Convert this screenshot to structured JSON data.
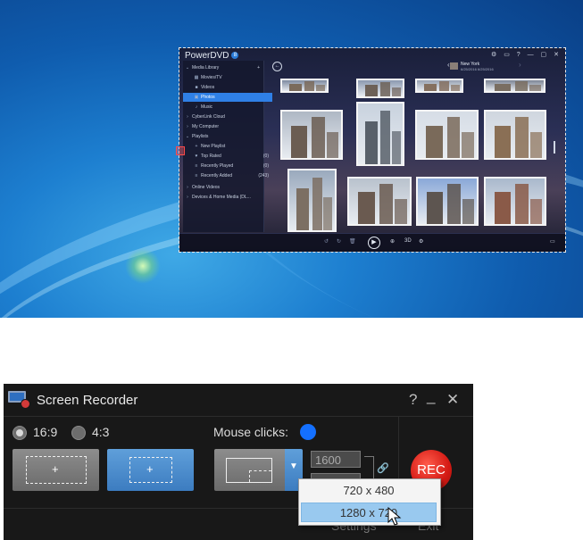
{
  "powerdvd": {
    "title": "PowerDVD",
    "badge": "8",
    "window_buttons": "⚙ ▭ ? — ▢ ✕",
    "sidebar": [
      {
        "label": "Media Library",
        "icon": "chevron-down",
        "count": "+",
        "indent": 0
      },
      {
        "label": "Movies/TV",
        "icon": "film",
        "count": "",
        "indent": 1
      },
      {
        "label": "Videos",
        "icon": "video",
        "count": "",
        "indent": 1
      },
      {
        "label": "Photos",
        "icon": "photo",
        "count": "",
        "indent": 1,
        "selected": true
      },
      {
        "label": "Music",
        "icon": "music",
        "count": "",
        "indent": 1
      },
      {
        "label": "CyberLink Cloud",
        "icon": "chevron-right",
        "count": "",
        "indent": 0
      },
      {
        "label": "My Computer",
        "icon": "chevron-right",
        "count": "",
        "indent": 0
      },
      {
        "label": "Playlists",
        "icon": "chevron-down",
        "count": "",
        "indent": 0
      },
      {
        "label": "New Playlist",
        "icon": "plus",
        "count": "",
        "indent": 1
      },
      {
        "label": "Top Rated",
        "icon": "heart",
        "count": "(0)",
        "indent": 1
      },
      {
        "label": "Recently Played",
        "icon": "list",
        "count": "(0)",
        "indent": 1
      },
      {
        "label": "Recently Added",
        "icon": "list",
        "count": "(243)",
        "indent": 1
      },
      {
        "label": "Online Videos",
        "icon": "chevron-right",
        "count": "",
        "indent": 0
      },
      {
        "label": "Devices & Home Media (DL...",
        "icon": "chevron-right",
        "count": "",
        "indent": 0
      }
    ],
    "location": {
      "name": "New York",
      "sub": "6/25/2016 6/25/2016"
    },
    "bottom_label_3d": "3D"
  },
  "recorder": {
    "title": "Screen Recorder",
    "help": "?",
    "minimize": "_",
    "close": "✕",
    "ratio_options": [
      "16:9",
      "4:3"
    ],
    "selected_ratio": "16:9",
    "mouse_clicks_label": "Mouse clicks:",
    "mouse_click_color": "#1470ff",
    "plus": "+",
    "width_value": "1600",
    "rec_label": "REC",
    "footer": {
      "settings": "Settings",
      "exit": "Exit"
    },
    "resolution_options": [
      "720 x 480",
      "1280 x 720"
    ],
    "highlighted_option": "1280 x 720"
  }
}
